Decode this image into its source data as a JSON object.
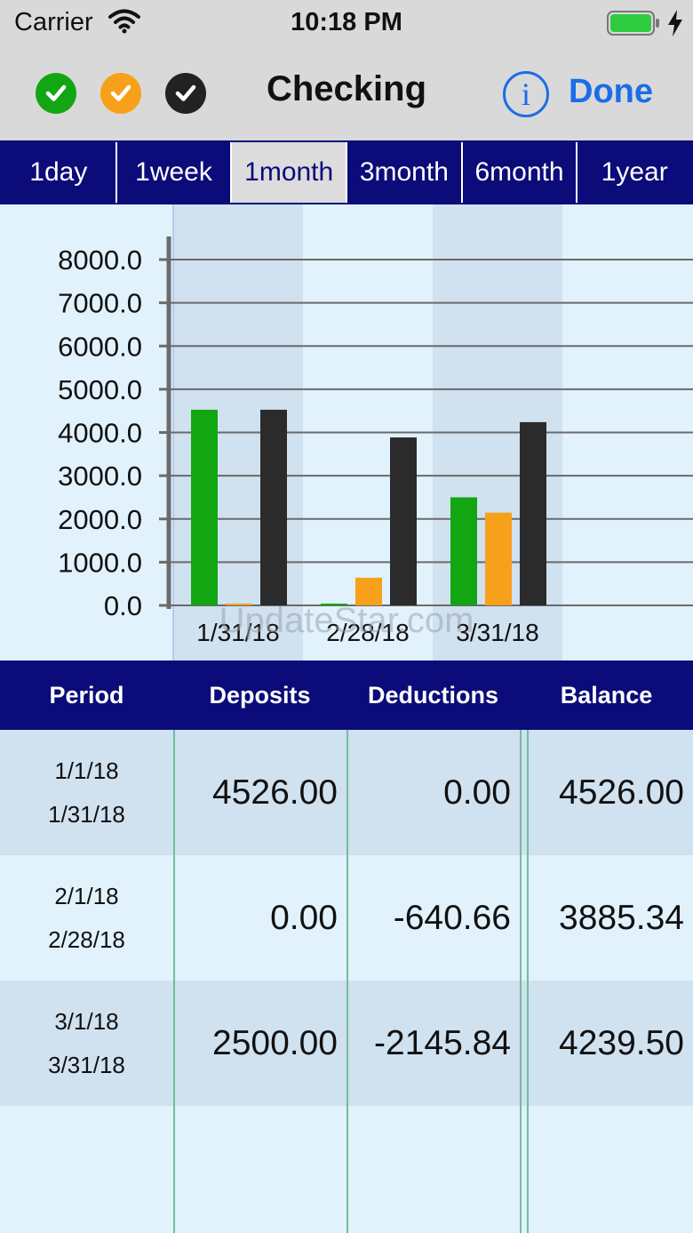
{
  "status_bar": {
    "carrier": "Carrier",
    "time": "10:18 PM"
  },
  "nav": {
    "title": "Checking",
    "info_label": "i",
    "done_label": "Done",
    "filters": [
      {
        "name": "green-check-icon",
        "color": "#13a613"
      },
      {
        "name": "orange-check-icon",
        "color": "#f7a11a"
      },
      {
        "name": "black-check-icon",
        "color": "#222222"
      }
    ]
  },
  "segments": {
    "items": [
      "1day",
      "1week",
      "1month",
      "3month",
      "6month",
      "1year"
    ],
    "selected": "1month"
  },
  "colors": {
    "deposits": "#13a613",
    "deductions": "#f7a11a",
    "balance": "#2b2b2b",
    "navy": "#0b0b7a",
    "accent": "#1a6de8"
  },
  "watermark": "UpdateStar.com",
  "chart_data": {
    "type": "bar",
    "categories": [
      "1/31/18",
      "2/28/18",
      "3/31/18"
    ],
    "series": [
      {
        "values": [
          4526.0,
          0.0,
          2500.0
        ],
        "color": "#13a613"
      },
      {
        "values": [
          0.0,
          640.66,
          2145.84
        ],
        "color": "#f7a11a"
      },
      {
        "values": [
          4526.0,
          3885.34,
          4239.5
        ],
        "color": "#2b2b2b"
      }
    ],
    "yticks": [
      "0.0",
      "1000.0",
      "2000.0",
      "3000.0",
      "4000.0",
      "5000.0",
      "6000.0",
      "7000.0",
      "8000.0"
    ],
    "ylim": [
      0,
      8000
    ],
    "grid": true
  },
  "table": {
    "headers": [
      "Period",
      "Deposits",
      "Deductions",
      "Balance"
    ],
    "rows": [
      {
        "period_start": "1/1/18",
        "period_end": "1/31/18",
        "deposits": "4526.00",
        "deductions": "0.00",
        "balance": "4526.00"
      },
      {
        "period_start": "2/1/18",
        "period_end": "2/28/18",
        "deposits": "0.00",
        "deductions": "-640.66",
        "balance": "3885.34"
      },
      {
        "period_start": "3/1/18",
        "period_end": "3/31/18",
        "deposits": "2500.00",
        "deductions": "-2145.84",
        "balance": "4239.50"
      }
    ]
  }
}
